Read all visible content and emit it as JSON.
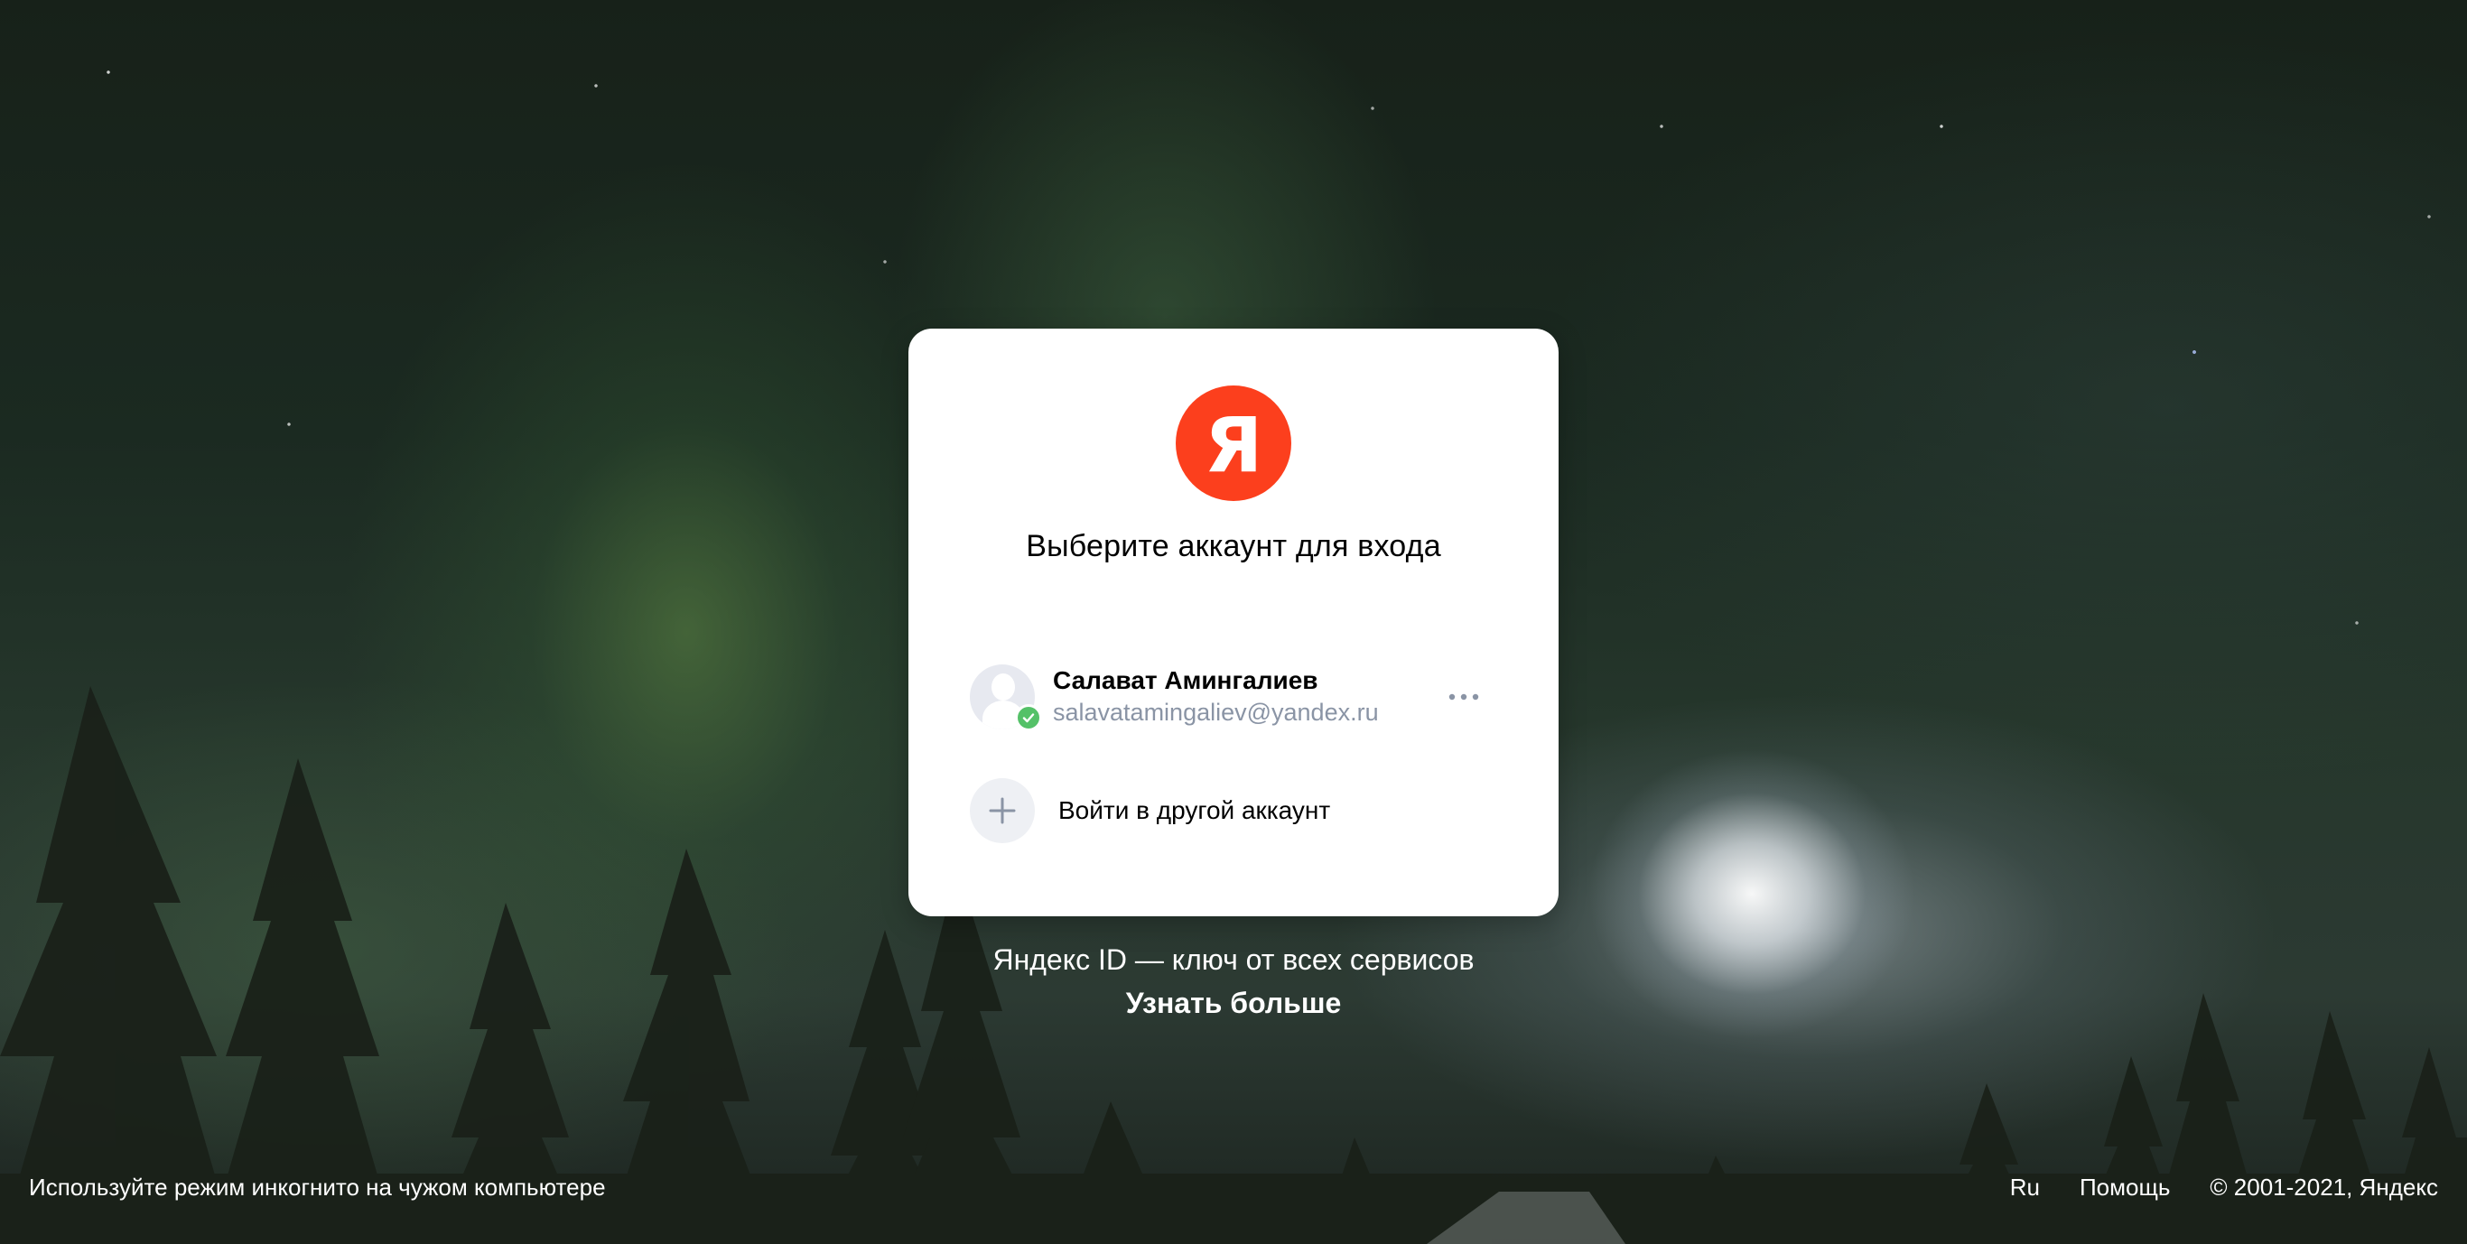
{
  "card": {
    "logo_letter": "Я",
    "title": "Выберите аккаунт для входа",
    "account": {
      "name": "Салават Амингалиев",
      "email": "salavatamingaliev@yandex.ru",
      "more_icon": "more-dots-icon",
      "verified_icon": "checkmark-icon"
    },
    "add_account": {
      "label": "Войти в другой аккаунт",
      "icon": "plus-icon"
    }
  },
  "promo": {
    "text": "Яндекс ID — ключ от всех сервисов",
    "link": "Узнать больше"
  },
  "footer": {
    "incognito_hint": "Используйте режим инкогнито на чужом компьютере",
    "language": "Ru",
    "help": "Помощь",
    "copyright": "© 2001-2021, Яндекс"
  },
  "colors": {
    "brand_red": "#fc3f1d",
    "verified_green": "#54c168",
    "email_gray": "#8a94a5"
  }
}
